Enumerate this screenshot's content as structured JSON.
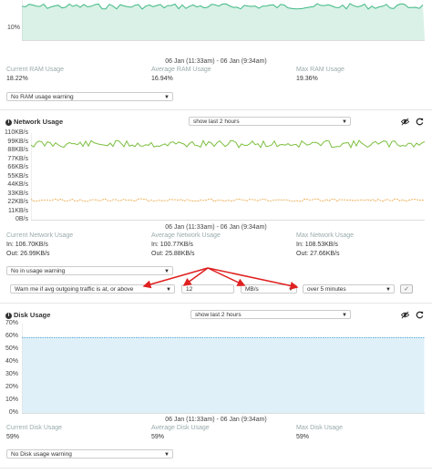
{
  "ram": {
    "ytick": "10%",
    "time_range": "06 Jan (11:33am) - 06 Jan (9:34am)",
    "stats": [
      {
        "label": "Current RAM Usage",
        "value": "18.22%"
      },
      {
        "label": "Average RAM Usage",
        "value": "16.94%"
      },
      {
        "label": "Max RAM Usage",
        "value": "19.36%"
      }
    ],
    "warning_select": "No RAM usage warning"
  },
  "network": {
    "title": "Network Usage",
    "period_select": "show last 2 hours",
    "yticks": [
      "110KB/s",
      "99KB/s",
      "88KB/s",
      "77KB/s",
      "66KB/s",
      "55KB/s",
      "44KB/s",
      "33KB/s",
      "22KB/s",
      "11KB/s",
      "0B/s"
    ],
    "time_range": "06 Jan (11:33am) - 06 Jan (9:34am)",
    "stats": [
      {
        "label": "Current Network Usage",
        "in": "In: 106.70KB/s",
        "out": "Out: 26.99KB/s"
      },
      {
        "label": "Average Network Usage",
        "in": "In: 100.77KB/s",
        "out": "Out: 25.88KB/s"
      },
      {
        "label": "Max Network Usage",
        "in": "In: 108.53KB/s",
        "out": "Out: 27.66KB/s"
      }
    ],
    "warning_select": "No in usage warning",
    "warn_condition": "Warn me if avg outgoing traffic is at, or above",
    "warn_value": "12",
    "warn_unit": "MB/s",
    "warn_duration": "over 5 minutes",
    "colors": {
      "in": "#7bbf3e",
      "out": "#e8a13a"
    }
  },
  "disk": {
    "title": "Disk Usage",
    "period_select": "show last 2 hours",
    "yticks": [
      "70%",
      "60%",
      "50%",
      "40%",
      "30%",
      "20%",
      "10%",
      "0%"
    ],
    "time_range": "06 Jan (11:33am) - 06 Jan (9:34am)",
    "stats": [
      {
        "label": "Current Disk Usage",
        "value": "59%"
      },
      {
        "label": "Average Disk Usage",
        "value": "59%"
      },
      {
        "label": "Max Disk Usage",
        "value": "59%"
      }
    ],
    "warning_select": "No Disk usage warning",
    "colors": {
      "line": "#5aa9d6",
      "fill": "#dff0f8"
    }
  },
  "annotation": {
    "color": "#e02020"
  },
  "ram_colors": {
    "line": "#3fb884",
    "fill": "#d9f1e6"
  },
  "icons": {
    "eye": "eye-icon",
    "refresh": "refresh-icon",
    "info": "info-icon",
    "check": "check-icon",
    "caret": "caret-down-icon"
  }
}
